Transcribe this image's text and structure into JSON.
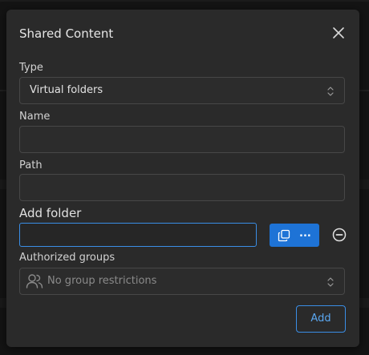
{
  "dialog": {
    "title": "Shared Content",
    "type": {
      "label": "Type",
      "value": "Virtual folders"
    },
    "name": {
      "label": "Name",
      "value": ""
    },
    "path": {
      "label": "Path",
      "value": ""
    },
    "add_folder": {
      "label": "Add folder",
      "value": "",
      "browse_label": "..."
    },
    "authorized_groups": {
      "label": "Authorized groups",
      "placeholder": "No group restrictions"
    },
    "add_button_label": "Add"
  },
  "colors": {
    "accent": "#1e73d6",
    "focus_border": "#3a8ee6",
    "dialog_bg": "#2a2a2a"
  },
  "icons": {
    "close": "close-icon",
    "select_chevron": "chevron-updown-icon",
    "browse": "copy-folders-icon",
    "remove": "minus-circle-icon",
    "groups": "users-icon"
  }
}
